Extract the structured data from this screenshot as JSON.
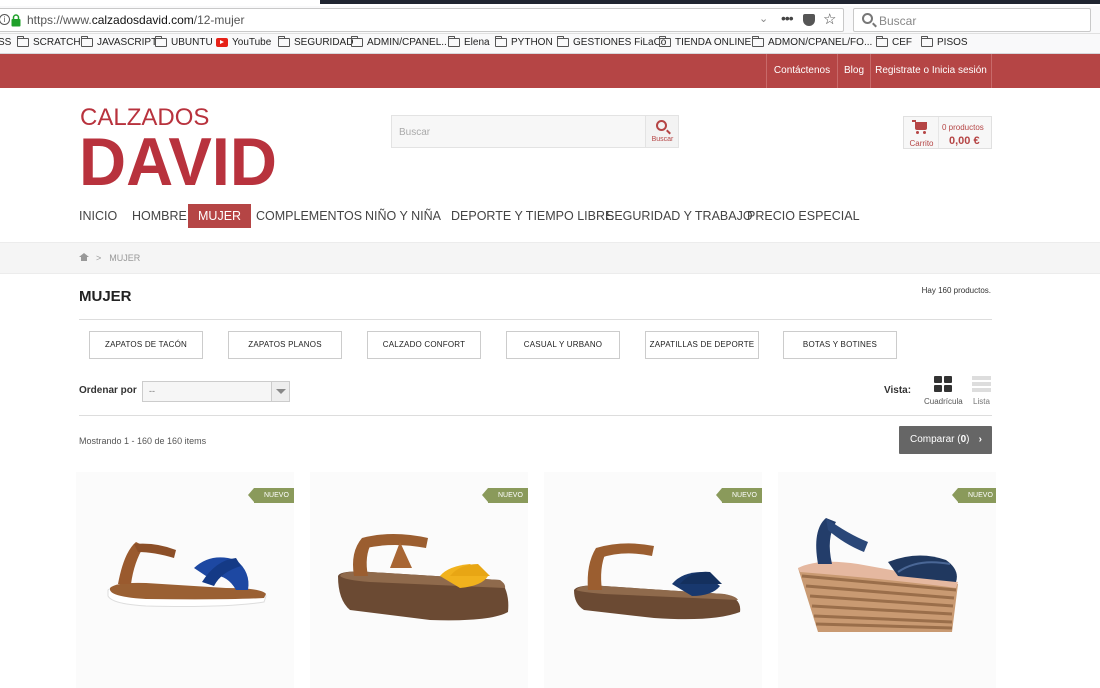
{
  "browser": {
    "url_prefix": "https://www.",
    "url_domain": "calzadosdavid.com",
    "url_path": "/12-mujer",
    "search_placeholder": "Buscar"
  },
  "bookmarks": [
    {
      "label": "SS",
      "icon": "none"
    },
    {
      "label": "SCRATCH",
      "icon": "folder-icon"
    },
    {
      "label": "JAVASCRIPT",
      "icon": "folder-icon"
    },
    {
      "label": "UBUNTU",
      "icon": "folder-icon"
    },
    {
      "label": "YouTube",
      "icon": "youtube-icon"
    },
    {
      "label": "SEGURIDAD",
      "icon": "folder-icon"
    },
    {
      "label": "ADMIN/CPANEL..",
      "icon": "folder-icon"
    },
    {
      "label": "Elena",
      "icon": "folder-icon"
    },
    {
      "label": "PYTHON",
      "icon": "folder-icon"
    },
    {
      "label": "GESTIONES FiLaCo",
      "icon": "folder-icon"
    },
    {
      "label": "TIENDA ONLINE",
      "icon": "folder-icon"
    },
    {
      "label": "ADMON/CPANEL/FO...",
      "icon": "folder-icon"
    },
    {
      "label": "CEF",
      "icon": "folder-icon"
    },
    {
      "label": "PISOS",
      "icon": "folder-icon"
    }
  ],
  "topbar": {
    "contact": "Contáctenos",
    "blog": "Blog",
    "account": "Registrate o Inicia sesión"
  },
  "logo": {
    "line1": "CALZADOS",
    "line2": "DAVID",
    "color": "#b8323d"
  },
  "header_search": {
    "placeholder": "Buscar",
    "button_label": "Buscar"
  },
  "cart": {
    "label": "Carrito",
    "count": "0 productos",
    "total": "0,00 €"
  },
  "nav": [
    {
      "label": "INICIO",
      "active": false
    },
    {
      "label": "HOMBRE",
      "active": false
    },
    {
      "label": "MUJER",
      "active": true
    },
    {
      "label": "COMPLEMENTOS",
      "active": false
    },
    {
      "label": "NIÑO Y NIÑA",
      "active": false
    },
    {
      "label": "DEPORTE Y TIEMPO LIBRE",
      "active": false
    },
    {
      "label": "SEGURIDAD Y TRABAJO",
      "active": false
    },
    {
      "label": "PRECIO ESPECIAL",
      "active": false
    }
  ],
  "breadcrumb": {
    "separator": ">",
    "current": "MUJER"
  },
  "category": {
    "title": "MUJER",
    "product_count": "Hay 160 productos.",
    "subcategories": [
      "ZAPATOS DE TACÓN",
      "ZAPATOS PLANOS",
      "CALZADO CONFORT",
      "CASUAL Y URBANO",
      "ZAPATILLAS DE DEPORTE",
      "BOTAS Y BOTINES"
    ],
    "sort_label": "Ordenar por",
    "sort_value": "--",
    "view_label": "Vista:",
    "view_grid": "Cuadrícula",
    "view_list": "Lista",
    "showing": "Mostrando 1 - 160 de 160 items",
    "compare_prefix": "Comparar (",
    "compare_count": "0",
    "compare_suffix": ")"
  },
  "products": [
    {
      "badge": "NUEVO"
    },
    {
      "badge": "NUEVO"
    },
    {
      "badge": "NUEVO"
    },
    {
      "badge": "NUEVO"
    }
  ],
  "colors": {
    "brand": "#b54545",
    "badge": "#8a9a5b",
    "compare": "#666666"
  }
}
